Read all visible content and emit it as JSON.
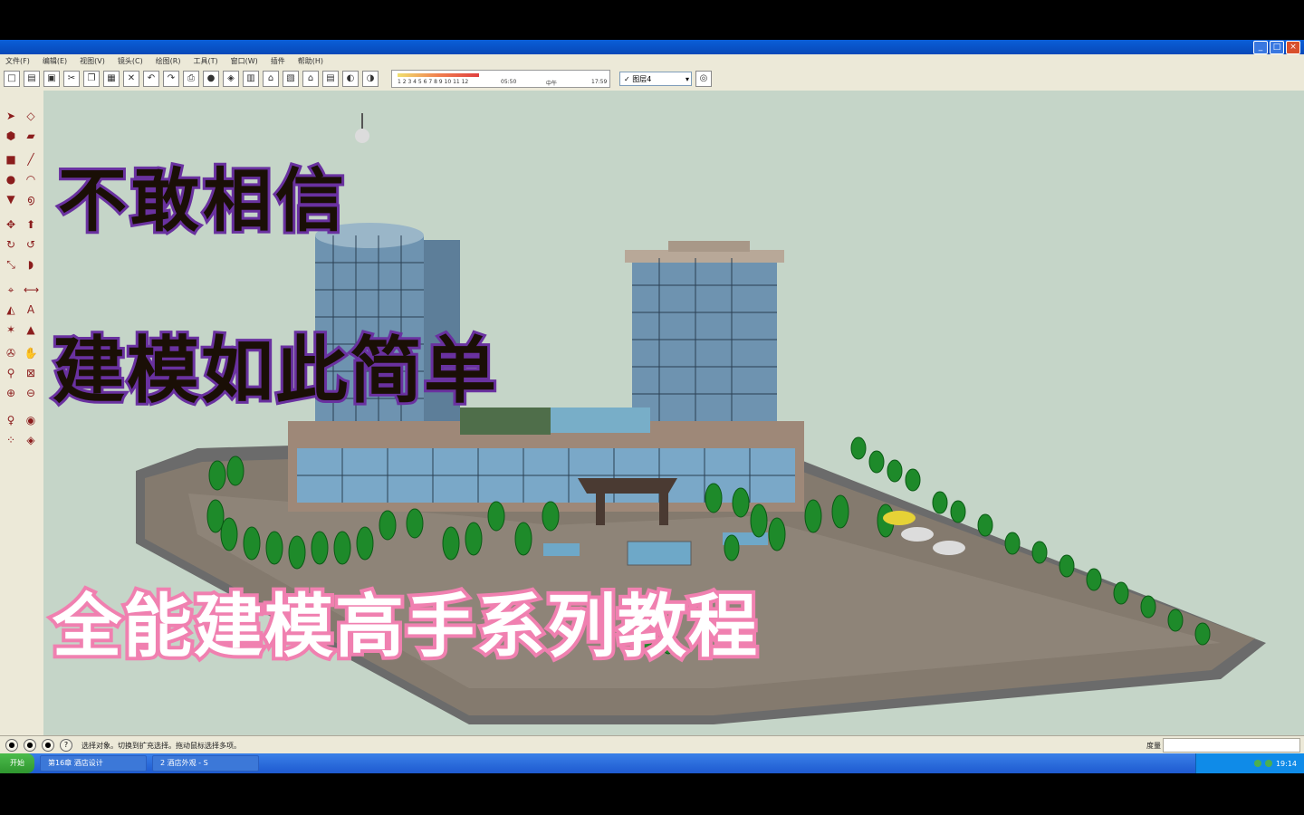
{
  "window": {
    "title": "",
    "buttons": [
      "_",
      "□",
      "×"
    ]
  },
  "menu": [
    "文件(F)",
    "编辑(E)",
    "视图(V)",
    "镜头(C)",
    "绘图(R)",
    "工具(T)",
    "窗口(W)",
    "插件",
    "帮助(H)"
  ],
  "toolbar": {
    "timeline_ticks": "1 2 3 4 5 6 7 8 9 10 11 12",
    "time_left": "05:50",
    "time_mid": "中午",
    "time_right": "17:59",
    "layer_checked": "✓",
    "layer_name": "图层4"
  },
  "overlay": {
    "line1": "不敢相信",
    "line2": "建模如此简单",
    "line3": "全能建模高手系列教程"
  },
  "status": {
    "message": "选择对象。切换到扩充选择。拖动鼠标选择多项。",
    "measure_label": "度量",
    "help_icon": "?"
  },
  "taskbar": {
    "start": "开始",
    "task1": "第16章 酒店设计",
    "task2": "2 酒店外观 - S",
    "clock": "19:14"
  },
  "colors": {
    "canvas": "#c5d5c8",
    "ground": "#6b6b6b",
    "tree": "#1e8a2a",
    "glass": "#7aa8c8"
  }
}
